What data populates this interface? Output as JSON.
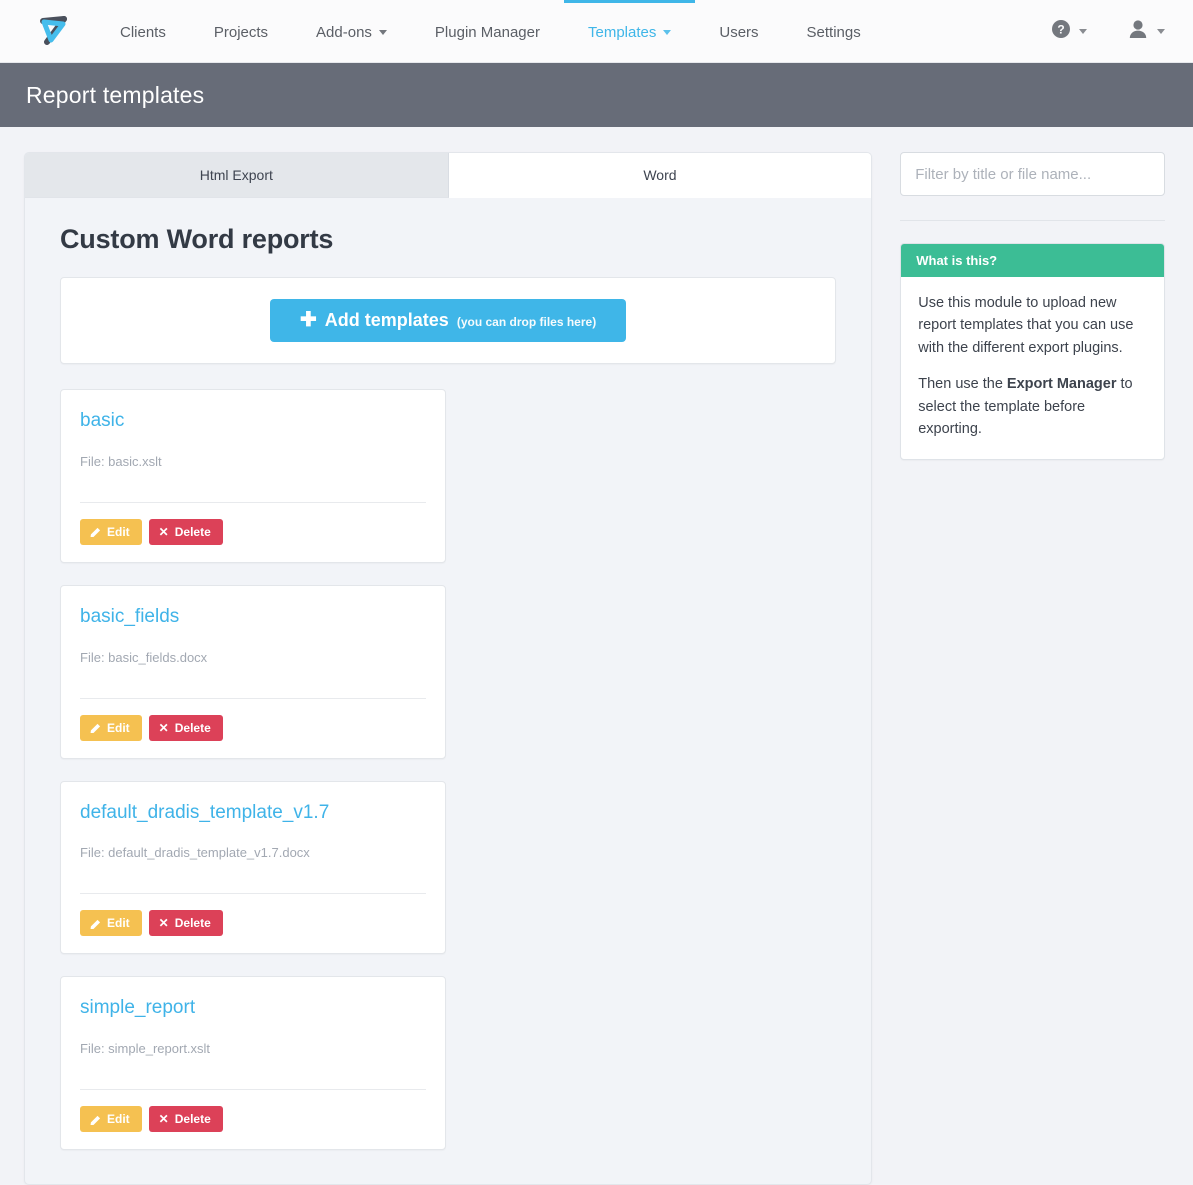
{
  "navbar": {
    "logo_alt": "dradis-logo",
    "items": [
      {
        "label": "Clients",
        "has_caret": false,
        "active": false
      },
      {
        "label": "Projects",
        "has_caret": false,
        "active": false
      },
      {
        "label": "Add-ons",
        "has_caret": true,
        "active": false
      },
      {
        "label": "Plugin Manager",
        "has_caret": false,
        "active": false
      },
      {
        "label": "Templates",
        "has_caret": true,
        "active": true
      },
      {
        "label": "Users",
        "has_caret": false,
        "active": false
      },
      {
        "label": "Settings",
        "has_caret": false,
        "active": false
      }
    ],
    "help_icon": "help-circle-icon",
    "user_icon": "user-avatar-icon",
    "accent_color": "#3fb6e8"
  },
  "page_header": {
    "title": "Report templates",
    "background_color": "#676c78"
  },
  "tabs": [
    {
      "label": "Html Export",
      "active": false
    },
    {
      "label": "Word",
      "active": true
    }
  ],
  "main": {
    "section_title": "Custom Word reports",
    "add_button": {
      "icon": "plus-icon",
      "label": "Add templates",
      "hint": "(you can drop files here)",
      "color": "#3fb6e8"
    },
    "file_label_prefix": "File: ",
    "edit_label": "Edit",
    "delete_label": "Delete",
    "edit_color": "#f5c151",
    "delete_color": "#dc4158",
    "templates": [
      {
        "title": "basic",
        "file": "File: basic.xslt"
      },
      {
        "title": "basic_fields",
        "file": "File: basic_fields.docx"
      },
      {
        "title": "default_dradis_template_v1.7",
        "file": "File: default_dradis_template_v1.7.docx"
      },
      {
        "title": "simple_report",
        "file": "File: simple_report.xslt"
      }
    ]
  },
  "sidebar": {
    "filter": {
      "value": "",
      "placeholder": "Filter by title or file name..."
    },
    "info_box": {
      "heading": "What is this?",
      "heading_color": "#3cbd95",
      "paragraph_1": "Use this module to upload new report templates that you can use with the different export plugins.",
      "paragraph_2_before": "Then use the ",
      "paragraph_2_bold": "Export Manager",
      "paragraph_2_after": " to select the template before exporting."
    }
  }
}
